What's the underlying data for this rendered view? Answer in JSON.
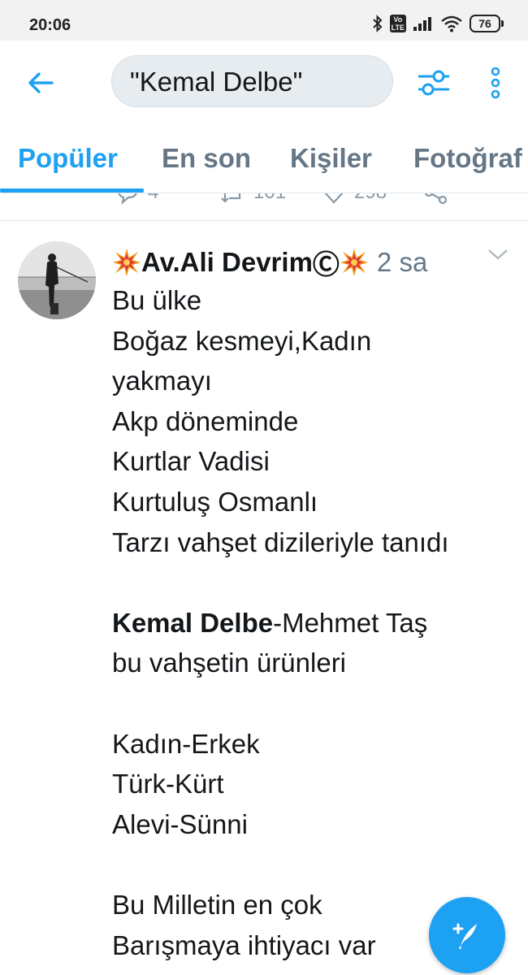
{
  "status_bar": {
    "time": "20:06",
    "battery": "76",
    "volte_label": "Vo LTE",
    "icons": [
      "bluetooth-icon",
      "volte-icon",
      "signal-icon",
      "wifi-icon",
      "battery-icon"
    ]
  },
  "header": {
    "search_query": "\"Kemal Delbe\"",
    "icons": [
      "back-arrow-icon",
      "filter-sliders-icon",
      "more-vertical-icon"
    ]
  },
  "tabs": [
    {
      "label": "Popüler",
      "active": true
    },
    {
      "label": "En son",
      "active": false
    },
    {
      "label": "Kişiler",
      "active": false
    },
    {
      "label": "Fotoğraf",
      "active": false
    }
  ],
  "previous_tweet_actions": {
    "reply_count": "4",
    "retweet_count": "101",
    "like_count": "298"
  },
  "tweet": {
    "author_name": "Av.Ali Devrim",
    "author_copyright": "Ⓒ",
    "time_ago": "2 sa",
    "lines": [
      "Bu ülke",
      "Boğaz kesmeyi,Kadın",
      "yakmayı",
      "Akp döneminde",
      "Kurtlar Vadisi",
      "Kurtuluş Osmanlı",
      "Tarzı vahşet dizileriyle tanıdı",
      "",
      "",
      "bu vahşetin ürünleri",
      "",
      "Kadın-Erkek",
      "Türk-Kürt",
      "Alevi-Sünni",
      "",
      "Bu Milletin en çok",
      "Barışmaya ihtiyacı var"
    ],
    "highlight_bold": "Kemal Delbe",
    "highlight_rest": "-Mehmet Taş"
  },
  "fab": {
    "icon": "compose-tweet-icon"
  },
  "colors": {
    "accent": "#1da1f2",
    "text": "#14171a",
    "muted": "#657786",
    "search_bg": "#e6ecf0",
    "status_bar_bg": "#f2f2f2"
  }
}
